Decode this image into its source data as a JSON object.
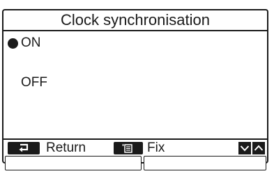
{
  "screen": {
    "title": "Clock synchronisation"
  },
  "options": [
    {
      "label": "ON",
      "selected": true
    },
    {
      "label": "OFF",
      "selected": false
    }
  ],
  "footer": {
    "return_label": "Return",
    "fix_label": "Fix",
    "return_icon": "return-arrow-icon",
    "fix_icon": "menu-icon",
    "down_icon": "chevron-down-icon",
    "up_icon": "chevron-up-icon"
  },
  "colors": {
    "foreground": "#1a1a1a",
    "background": "#ffffff"
  }
}
